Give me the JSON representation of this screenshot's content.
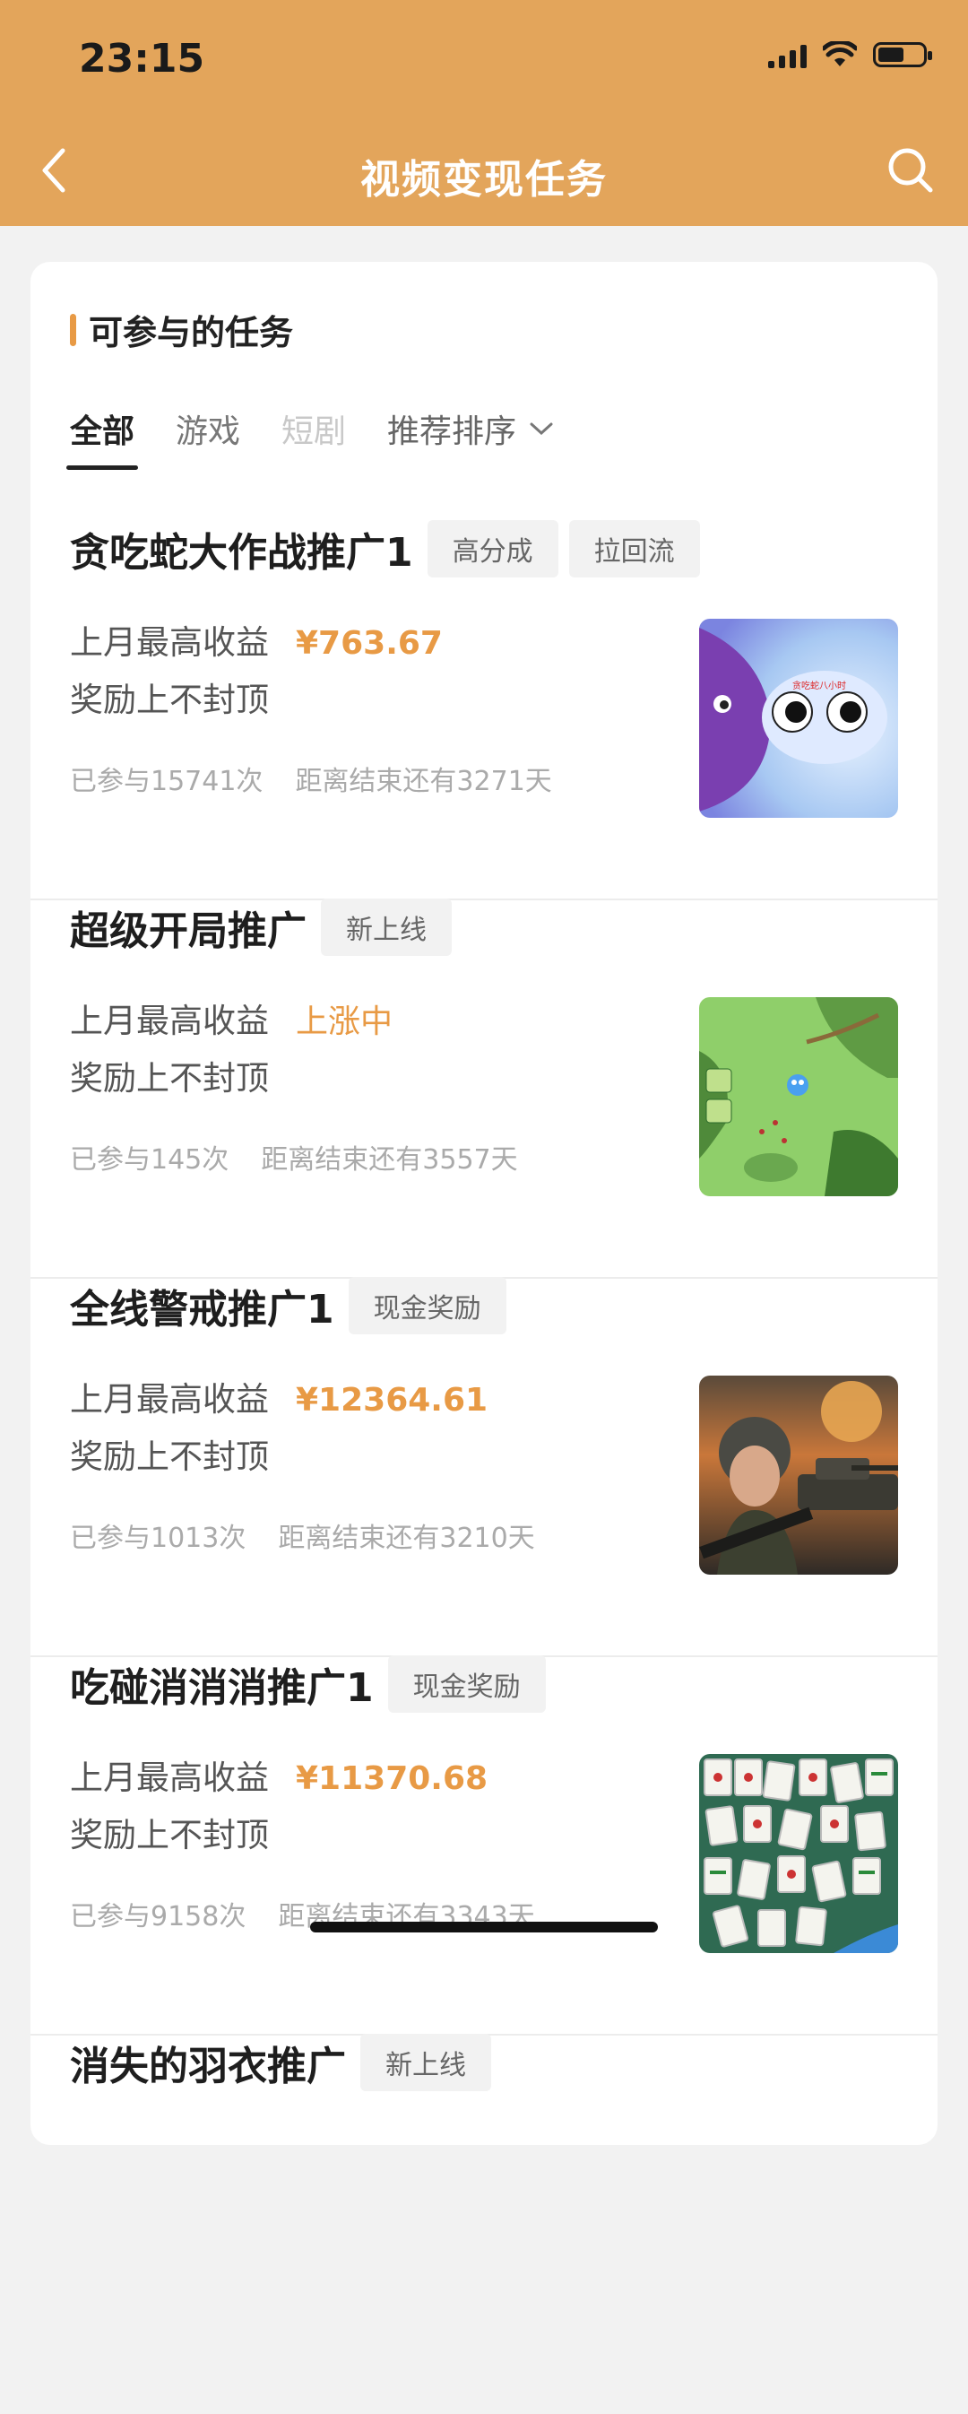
{
  "status_bar": {
    "time": "23:15"
  },
  "nav": {
    "title": "视频变现任务"
  },
  "section": {
    "title": "可参与的任务"
  },
  "tabs": [
    {
      "label": "全部"
    },
    {
      "label": "游戏"
    },
    {
      "label": "短剧"
    },
    {
      "label": "推荐排序"
    }
  ],
  "earn_label": "上月最高收益",
  "cap_label": "奖励上不封顶",
  "tasks": [
    {
      "title": "贪吃蛇大作战推广1",
      "tags": [
        "高分成",
        "拉回流"
      ],
      "earnings": "¥763.67",
      "participants": "已参与15741次",
      "remaining": "距离结束还有3271天",
      "thumb_label": "贪吃蛇八小时"
    },
    {
      "title": "超级开局推广",
      "tags": [
        "新上线"
      ],
      "earnings": "上涨中",
      "participants": "已参与145次",
      "remaining": "距离结束还有3557天"
    },
    {
      "title": "全线警戒推广1",
      "tags": [
        "现金奖励"
      ],
      "earnings": "¥12364.61",
      "participants": "已参与1013次",
      "remaining": "距离结束还有3210天"
    },
    {
      "title": "吃碰消消消推广1",
      "tags": [
        "现金奖励"
      ],
      "earnings": "¥11370.68",
      "participants": "已参与9158次",
      "remaining": "距离结束还有3343天"
    },
    {
      "title": "消失的羽衣推广",
      "tags": [
        "新上线"
      ]
    }
  ]
}
